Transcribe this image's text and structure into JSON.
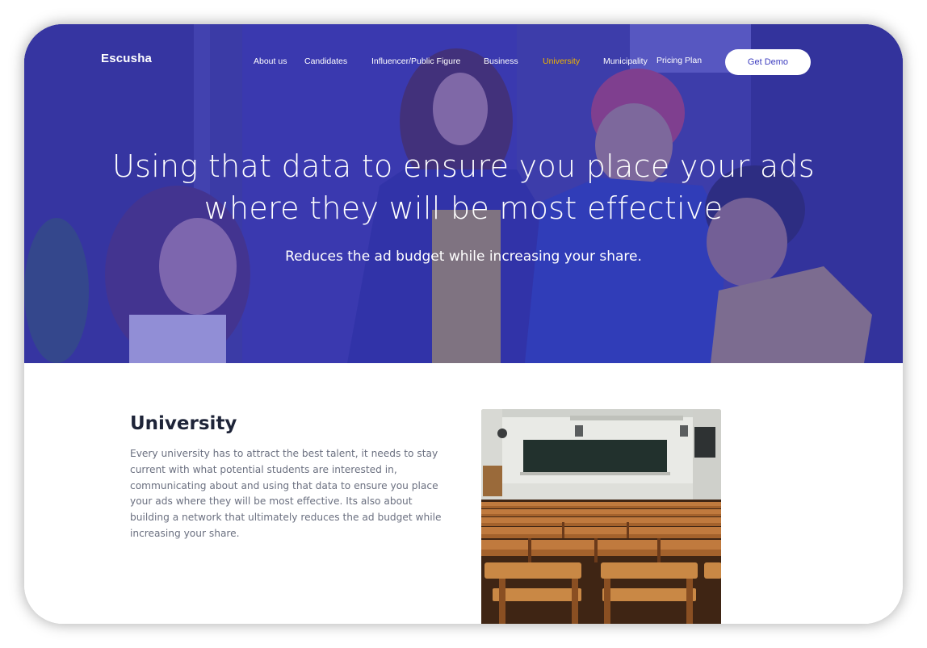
{
  "brand": "Escusha",
  "nav": {
    "items": [
      {
        "label": "About us",
        "active": false
      },
      {
        "label": "Candidates",
        "active": false
      },
      {
        "label": "Influencer/Public Figure",
        "active": false
      },
      {
        "label": "Business",
        "active": false
      },
      {
        "label": "University",
        "active": true
      },
      {
        "label": "Municipality",
        "active": false
      },
      {
        "label": "Pricing Plan",
        "active": false
      }
    ],
    "cta_label": "Get Demo"
  },
  "hero": {
    "title": "Using that data to ensure you place your ads where they will be most effective",
    "subtitle": "Reduces the ad budget while increasing your share."
  },
  "section": {
    "title": "University",
    "text": "Every university has to attract the best talent, it needs to stay current with what potential students are interested in, communicating about and using that data to ensure you place your ads where they will be most effective. Its also about building a network that ultimately reduces the ad budget while increasing your share."
  },
  "colors": {
    "overlay": "#3a3ab9",
    "active_nav": "#f0b400",
    "heading": "#1e2438",
    "body_text": "#6b7080",
    "cta_text": "#3c3cbf"
  },
  "icons": {
    "hero_image": "people-meeting-photo",
    "section_image": "lecture-hall-photo"
  }
}
